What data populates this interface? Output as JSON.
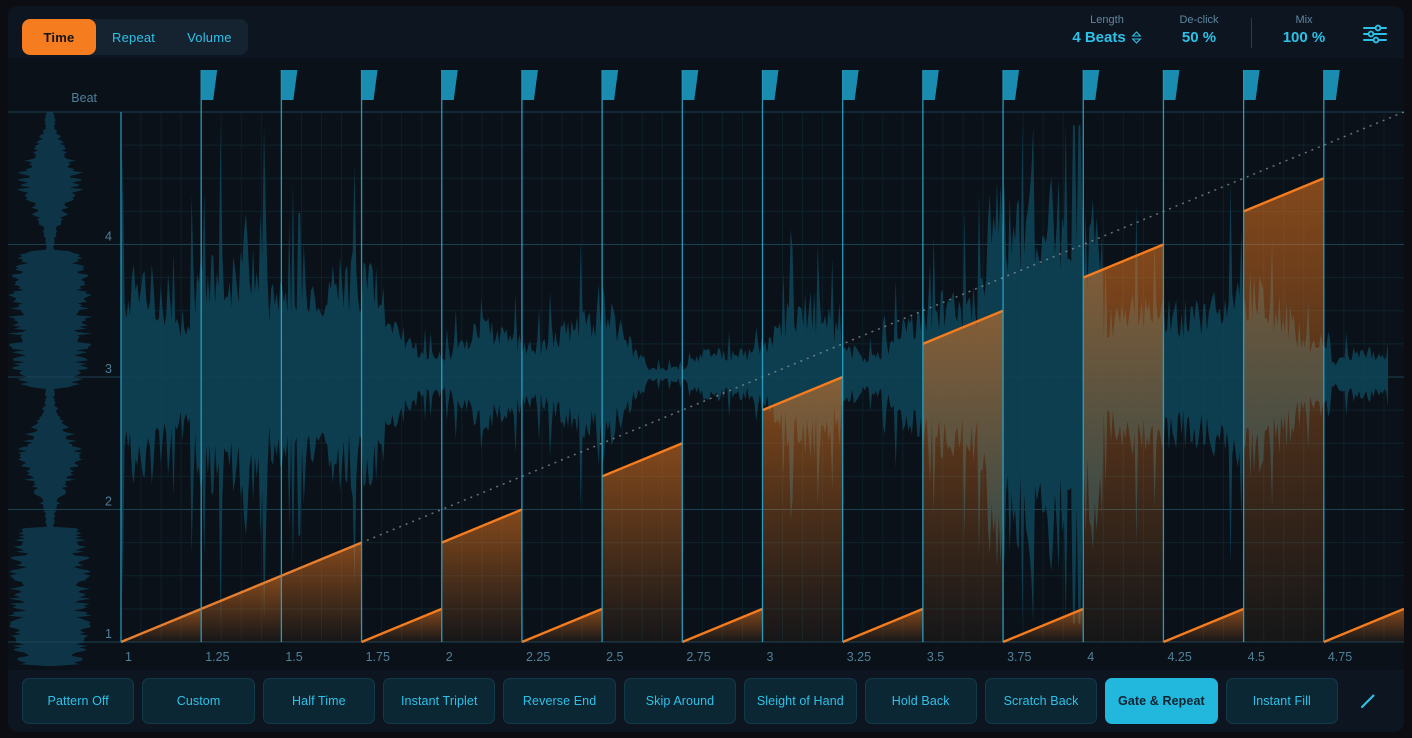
{
  "theme": {
    "accent_orange": "#f57c1f",
    "accent_cyan": "#2ec1e8",
    "marker_cyan": "#1b94b8",
    "waveform": "#0e4256",
    "panel_bg": "#0d1620",
    "chart_bg": "#0a1118",
    "app_bg": "#0b0d12"
  },
  "header": {
    "tabs": [
      {
        "label": "Time",
        "active": true
      },
      {
        "label": "Repeat",
        "active": false
      },
      {
        "label": "Volume",
        "active": false
      }
    ],
    "params": [
      {
        "name": "length",
        "label": "Length",
        "value": "4 Beats",
        "stepper": true
      },
      {
        "name": "declick",
        "label": "De-click",
        "value": "50 %",
        "stepper": false
      },
      {
        "name": "mix",
        "label": "Mix",
        "value": "100 %",
        "stepper": false
      }
    ],
    "settings_icon": "sliders-icon"
  },
  "chart_data": {
    "type": "line",
    "title": "",
    "ylabel": "Beat",
    "xlabel": "",
    "grid": true,
    "legend_position": "none",
    "xlim": [
      1,
      5
    ],
    "ylim": [
      1,
      5
    ],
    "x_ticks": [
      "1",
      "1.25",
      "1.5",
      "1.75",
      "2",
      "2.25",
      "2.5",
      "2.75",
      "3",
      "3.25",
      "3.5",
      "3.75",
      "4",
      "4.25",
      "4.5",
      "4.75"
    ],
    "x_tick_values": [
      1,
      1.25,
      1.5,
      1.75,
      2,
      2.25,
      2.5,
      2.75,
      3,
      3.25,
      3.5,
      3.75,
      4,
      4.25,
      4.5,
      4.75
    ],
    "y_ticks": [
      "1",
      "2",
      "3",
      "4"
    ],
    "y_tick_values": [
      1,
      2,
      3,
      4
    ],
    "series": [
      {
        "name": "Identity (unprocessed reference)",
        "style": "dotted",
        "color": "#8a9298",
        "points": [
          [
            1,
            1
          ],
          [
            5,
            5
          ]
        ]
      },
      {
        "name": "Gate & Repeat time map",
        "style": "sawtooth-ramp",
        "color": "#f57c1f",
        "fill": "gradient-orange",
        "segment_length_beats": 0.25,
        "ramp_rise_beats": 0.25,
        "segments": [
          {
            "x0": 1.0,
            "x1": 1.25,
            "y0": 1.0,
            "y1": 1.25
          },
          {
            "x0": 1.25,
            "x1": 1.5,
            "y0": 1.25,
            "y1": 1.5
          },
          {
            "x0": 1.5,
            "x1": 1.75,
            "y0": 1.5,
            "y1": 1.75
          },
          {
            "x0": 1.75,
            "x1": 2.0,
            "y0": 1.0,
            "y1": 1.25
          },
          {
            "x0": 2.0,
            "x1": 2.25,
            "y0": 1.75,
            "y1": 2.0
          },
          {
            "x0": 2.25,
            "x1": 2.5,
            "y0": 1.0,
            "y1": 1.25
          },
          {
            "x0": 2.5,
            "x1": 2.75,
            "y0": 2.25,
            "y1": 2.5
          },
          {
            "x0": 2.75,
            "x1": 3.0,
            "y0": 1.0,
            "y1": 1.25
          },
          {
            "x0": 3.0,
            "x1": 3.25,
            "y0": 2.75,
            "y1": 3.0
          },
          {
            "x0": 3.25,
            "x1": 3.5,
            "y0": 1.0,
            "y1": 1.25
          },
          {
            "x0": 3.5,
            "x1": 3.75,
            "y0": 3.25,
            "y1": 3.5
          },
          {
            "x0": 3.75,
            "x1": 4.0,
            "y0": 1.0,
            "y1": 1.25
          },
          {
            "x0": 4.0,
            "x1": 4.25,
            "y0": 3.75,
            "y1": 4.0
          },
          {
            "x0": 4.25,
            "x1": 4.5,
            "y0": 1.0,
            "y1": 1.25
          },
          {
            "x0": 4.5,
            "x1": 4.75,
            "y0": 4.25,
            "y1": 4.5
          },
          {
            "x0": 4.75,
            "x1": 5.0,
            "y0": 1.0,
            "y1": 1.25
          }
        ]
      }
    ],
    "markers": {
      "name": "beat-markers",
      "color": "#1b94b8",
      "positions": [
        1.25,
        1.5,
        1.75,
        2,
        2.25,
        2.5,
        2.75,
        3,
        3.25,
        3.5,
        3.75,
        4,
        4.25,
        4.5,
        4.75
      ]
    },
    "background_waveform": {
      "name": "audio-waveform",
      "color": "#0e4256",
      "orientation": "horizontal",
      "extent_x": [
        1,
        4.95
      ]
    },
    "ruler_waveform": {
      "name": "vertical-audio-waveform",
      "color": "#0e3a4c",
      "orientation": "vertical"
    }
  },
  "footer": {
    "presets": [
      {
        "label": "Pattern Off",
        "active": false
      },
      {
        "label": "Custom",
        "active": false
      },
      {
        "label": "Half Time",
        "active": false
      },
      {
        "label": "Instant Triplet",
        "active": false
      },
      {
        "label": "Reverse End",
        "active": false
      },
      {
        "label": "Skip Around",
        "active": false
      },
      {
        "label": "Sleight of Hand",
        "active": false
      },
      {
        "label": "Hold Back",
        "active": false
      },
      {
        "label": "Scratch Back",
        "active": false
      },
      {
        "label": "Gate & Repeat",
        "active": true
      },
      {
        "label": "Instant Fill",
        "active": false
      }
    ],
    "edit_icon": "pencil-icon"
  }
}
